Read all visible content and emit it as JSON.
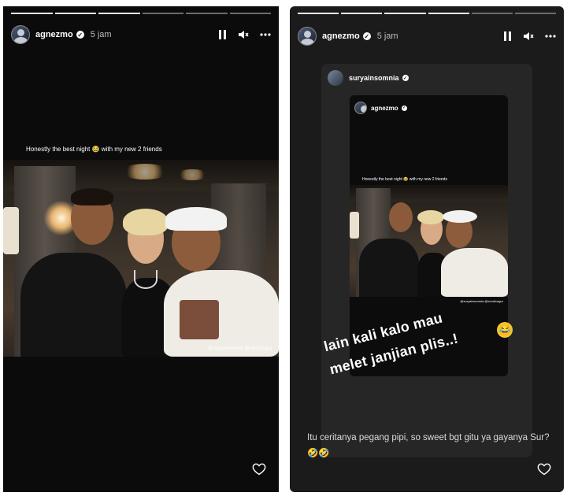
{
  "left_story": {
    "progress": {
      "segments": 6,
      "completed": 3
    },
    "username": "agnezmo",
    "time": "5 jam",
    "caption": "Honestly the best night 😂 with my new 2 friends",
    "photo_tags": "@suryainsomnia @xendicagur"
  },
  "right_story": {
    "progress": {
      "segments": 6,
      "completed": 4
    },
    "username": "agnezmo",
    "time": "5 jam",
    "shared_username": "suryainsomnia",
    "inner_username": "agnezmo",
    "inner_caption": "Honestly the best night 😂 with my new 2 friends",
    "inner_tags": "@suryainsomnia @xendicagur",
    "big_text_line1": "lain kali kalo mau",
    "big_text_line2": "melet janjian plis..!",
    "comment": "Itu ceritanya pegang pipi, so sweet bgt gitu ya gayanya Sur? 🤣🤣"
  },
  "icons": {
    "verified": "verified-badge-icon",
    "pause": "pause-icon",
    "mute": "speaker-muted-icon",
    "more": "more-horizontal-icon",
    "heart": "heart-outline-icon",
    "laugh": "face-with-tears-of-joy-icon"
  }
}
